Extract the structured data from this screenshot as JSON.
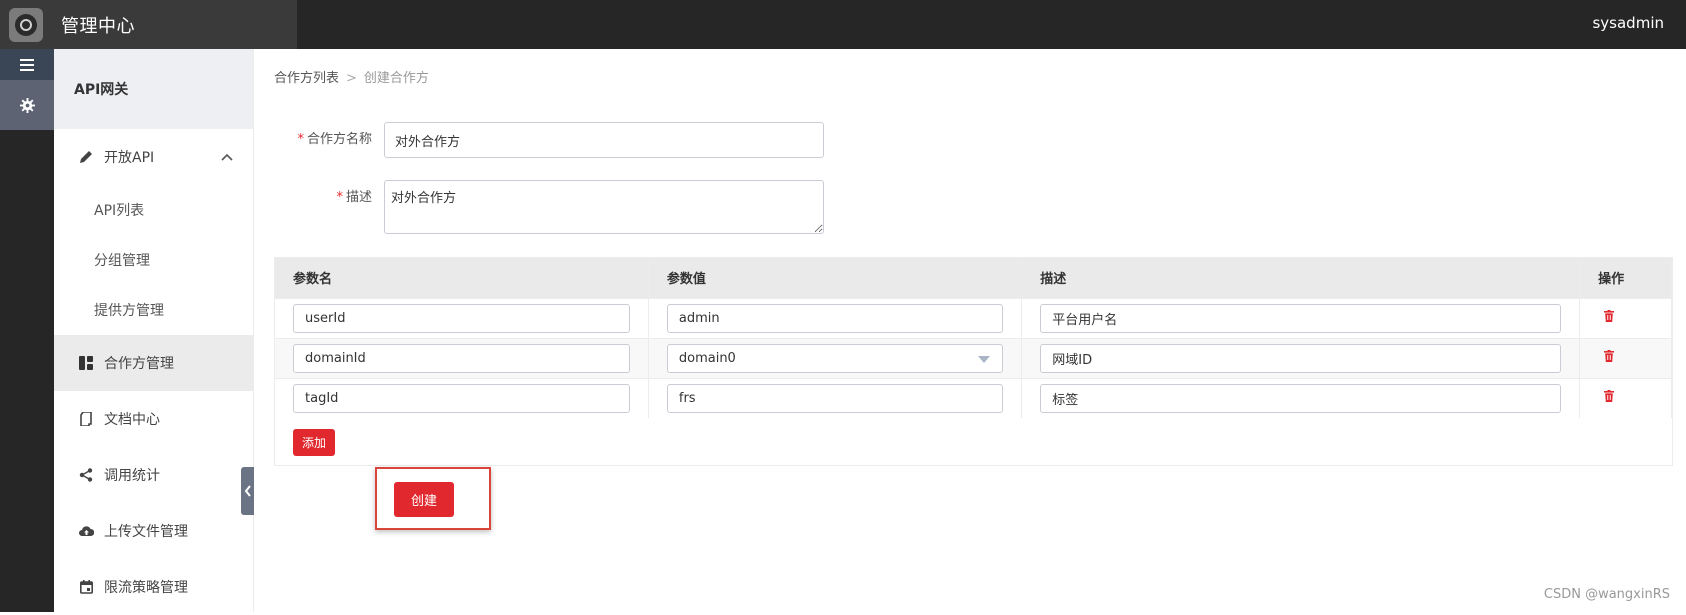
{
  "header": {
    "title": "管理中心",
    "user": "sysadmin"
  },
  "sidebar": {
    "section_title": "API网关",
    "items": [
      {
        "label": "开放API",
        "icon": "pencil-icon"
      },
      {
        "label": "API列表"
      },
      {
        "label": "分组管理"
      },
      {
        "label": "提供方管理"
      },
      {
        "label": "合作方管理",
        "icon": "grid-icon"
      },
      {
        "label": "文档中心",
        "icon": "document-icon"
      },
      {
        "label": "调用统计",
        "icon": "share-icon"
      },
      {
        "label": "上传文件管理",
        "icon": "cloud-upload-icon"
      },
      {
        "label": "限流策略管理",
        "icon": "calendar-icon"
      }
    ]
  },
  "breadcrumb": {
    "parent": "合作方列表",
    "separator": ">",
    "current": "创建合作方"
  },
  "form": {
    "name_label": "合作方名称",
    "name_value": "对外合作方",
    "desc_label": "描述",
    "desc_value": "对外合作方",
    "required_mark": "*"
  },
  "params_table": {
    "headers": [
      "参数名",
      "参数值",
      "描述",
      "操作"
    ],
    "rows": [
      {
        "name": "userId",
        "value": "admin",
        "desc": "平台用户名"
      },
      {
        "name": "domainId",
        "value": "domain0",
        "desc": "网域ID"
      },
      {
        "name": "tagId",
        "value": "frs",
        "desc": "标签"
      }
    ],
    "add_label": "添加"
  },
  "actions": {
    "create_label": "创建"
  },
  "watermark": "CSDN @wangxinRS",
  "colors": {
    "accent": "#e0282e",
    "topbar": "#262626"
  }
}
